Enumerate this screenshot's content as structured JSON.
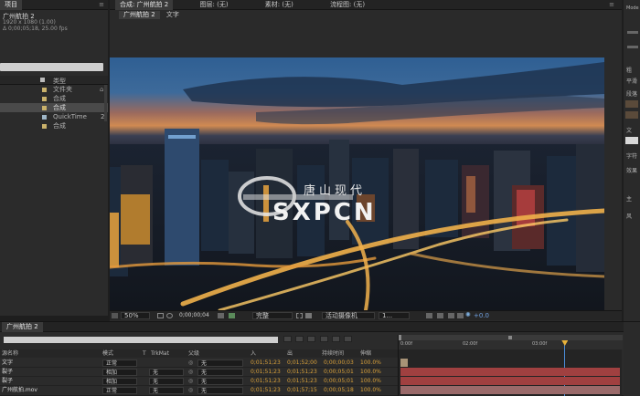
{
  "project": {
    "panel_title": "项目",
    "comp_name": "广州航拍 2",
    "info_line1": "1920 x 1080 (1.00)",
    "info_line2": "Δ 0;00;05;18, 25.00 fps",
    "col_type": "类型",
    "items": [
      {
        "type": "文件夹",
        "count": ""
      },
      {
        "type": "合成",
        "count": ""
      },
      {
        "type": "合成",
        "count": ""
      },
      {
        "type": "QuickTime",
        "count": "2"
      },
      {
        "type": "合成",
        "count": ""
      }
    ]
  },
  "viewer": {
    "tabs": [
      {
        "label": "合成: 广州航拍 2"
      },
      {
        "label": "图层: (无)"
      },
      {
        "label": "素材: (无)"
      },
      {
        "label": "流程图: (无)"
      }
    ],
    "subtabs": [
      "广州航拍 2",
      "文字"
    ],
    "watermark_brand": "唐山现代",
    "watermark_text": "SXPCN",
    "zoom": "50%",
    "timecode": "0;00;00;04",
    "resolution": "完整",
    "camera": "活动摄像机",
    "views": "1...",
    "exposure": "+0.0"
  },
  "timeline": {
    "tab": "广州航拍 2",
    "columns": {
      "name": "源名称",
      "mode": "模式",
      "t": "T",
      "trkmat": "TrkMat",
      "parent": "父级",
      "in": "入",
      "out": "出",
      "duration": "持续时间",
      "stretch": "伸缩"
    },
    "layers": [
      {
        "name": "文字",
        "mode": "正常",
        "trkmat": "",
        "parent": "无",
        "in": "0;01;51;23",
        "out": "0;01;52;00",
        "duration": "0;00;00;03",
        "stretch": "100.0%"
      },
      {
        "name": "裂子",
        "mode": "相加",
        "trkmat": "无",
        "parent": "无",
        "in": "0;01;51;23",
        "out": "0;01;51;23",
        "duration": "0;00;05;01",
        "stretch": "100.0%"
      },
      {
        "name": "裂子",
        "mode": "相加",
        "trkmat": "无",
        "parent": "无",
        "in": "0;01;51;23",
        "out": "0;01;51;23",
        "duration": "0;00;05;01",
        "stretch": "100.0%"
      },
      {
        "name": "广州航拍.mov",
        "mode": "正常",
        "trkmat": "无",
        "parent": "无",
        "in": "0;01;51;23",
        "out": "0;01;57;15",
        "duration": "0;00;05;18",
        "stretch": "100.0%"
      }
    ],
    "ruler": [
      "0:00f",
      "02:00f",
      "03:00f"
    ],
    "playhead_position": 0.74,
    "colors": {
      "bar_tan": "#a89377",
      "bar_red": "#a04040",
      "bar_pink": "#9a6a6a"
    }
  },
  "right": {
    "labels": [
      "Mode",
      "粗",
      "平滑",
      "段落",
      "文",
      "字符",
      "效果",
      "主",
      "风"
    ]
  }
}
